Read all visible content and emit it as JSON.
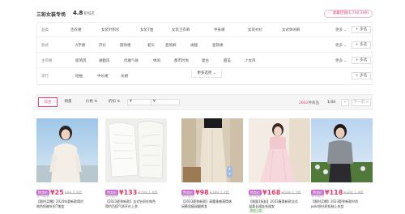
{
  "header": {
    "shop_name": "三彩女装专场",
    "score": "4.8",
    "score_label": "折扣店",
    "fav_label": "收藏店铺(1,730,349)"
  },
  "filters": [
    {
      "label": "品类",
      "options": [
        "连衣裙",
        "女装针织衫",
        "女装T恤",
        "女装卫衣裤",
        "半身裙",
        "女装衬衫",
        "女式休闲裤"
      ],
      "more": "更多",
      "multi": "多选"
    },
    {
      "label": "款式",
      "options": [
        "A字裙",
        "开衫",
        "圆领裙",
        "套头",
        "直筒裤",
        "阔腿",
        "直筒裙"
      ],
      "more": "更多",
      "multi": "多选"
    },
    {
      "label": "主风格",
      "options": [
        "极简风",
        "通勤风",
        "优雅气质",
        "休闲",
        "都市时尚",
        "复古",
        "甜美",
        "少女风"
      ],
      "more": "更多",
      "multi": "多选"
    },
    {
      "label": "流行",
      "options": [
        "短袖",
        "中长裙",
        "长裙"
      ],
      "more": "",
      "multi": "多选"
    }
  ],
  "more_options": "更多选项",
  "sort": {
    "tabs": [
      "综合",
      "销量",
      "价格",
      "折扣"
    ],
    "price_from": "¥",
    "price_to": "¥",
    "count": "2662",
    "count_suffix": "件商品",
    "page": "1/34",
    "prev": "<",
    "next": "下一页"
  },
  "products": [
    {
      "tag": "特卖价",
      "price": "¥25",
      "orig": "¥99 0.9折",
      "promo": "领卡返利",
      "line1": "【限时买赠】2024年夏新款简约",
      "line2": "纯色短袖针织T恤女",
      "badge": ""
    },
    {
      "tag": "特卖价",
      "price": "¥133",
      "orig": "¥299 1.8折",
      "promo": "领卡返利",
      "line1": "【2023夏季新款】法式针织衫纯色",
      "line2": "简约百搭气质开衫上衣",
      "badge": ""
    },
    {
      "tag": "特卖价",
      "price": "¥98",
      "orig": "¥399 2.4折",
      "promo": "领卡返利",
      "line1": "【2023夏季新款】高腰垂感直筒休",
      "line2": "闲裤显瘦阔腿裤女",
      "badge": ""
    },
    {
      "tag": "特卖价",
      "price": "¥168",
      "orig": "¥699 2.5折",
      "promo": "领卡返利",
      "line1": "【限量1折起】2023春夏新款法式",
      "line2": "温柔长裙连衣裙女",
      "badge": "新品上架"
    },
    {
      "tag": "特卖价",
      "price": "¥118",
      "orig": "¥399 2.9折",
      "promo": "领卡返利",
      "line1": "【限时买赠】2023夏季新款时尚",
      "line2": "polo领针织短袖上衣女",
      "badge": ""
    }
  ],
  "colors": {
    "accent": "#e8487a",
    "tag": "#c870d2",
    "price": "#e23a6b"
  }
}
